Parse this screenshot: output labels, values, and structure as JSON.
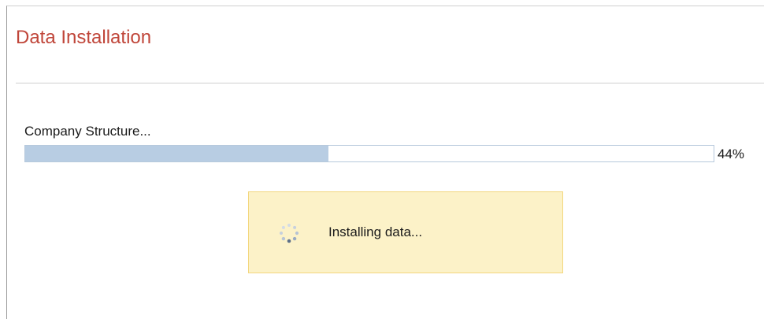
{
  "page": {
    "title": "Data Installation"
  },
  "task": {
    "label": "Company Structure...",
    "progress_percent": 44,
    "progress_text": "44%"
  },
  "status": {
    "message": "Installing data...",
    "icon": "spinner-icon"
  },
  "colors": {
    "title": "#c0463a",
    "progress_fill": "#b8cde3",
    "progress_border": "#b7c9dc",
    "status_background": "#fcf2c8",
    "status_border": "#f3d77f"
  }
}
